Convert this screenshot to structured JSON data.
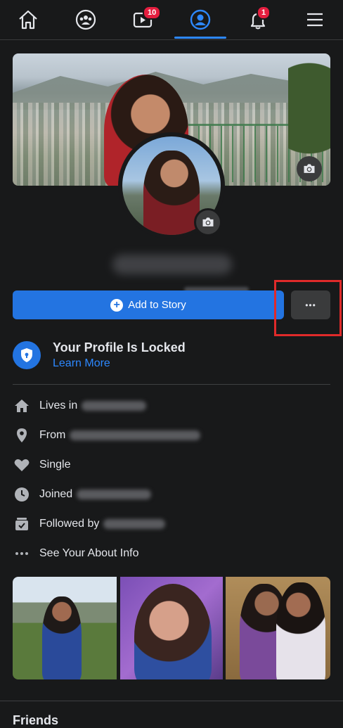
{
  "nav": {
    "items": [
      {
        "name": "home",
        "icon": "home-icon"
      },
      {
        "name": "groups",
        "icon": "groups-icon"
      },
      {
        "name": "watch",
        "icon": "video-icon",
        "badge": "10"
      },
      {
        "name": "profile",
        "icon": "profile-icon",
        "active": true
      },
      {
        "name": "notifications",
        "icon": "bell-icon",
        "badge": "1"
      },
      {
        "name": "menu",
        "icon": "menu-icon"
      }
    ]
  },
  "profile": {
    "add_story_label": "Add to Story",
    "more_label": "•••"
  },
  "lock": {
    "title": "Your Profile Is Locked",
    "link": "Learn More"
  },
  "intro": {
    "lives_in": "Lives in",
    "from": "From",
    "relationship": "Single",
    "joined": "Joined",
    "followed_by": "Followed by",
    "see_about": "See Your About Info"
  },
  "sections": {
    "friends_label": "Friends"
  },
  "colors": {
    "accent": "#2374e1",
    "link": "#2d88ff",
    "badge": "#e41e3f",
    "highlight": "#e02a2a",
    "background": "#18191a"
  }
}
